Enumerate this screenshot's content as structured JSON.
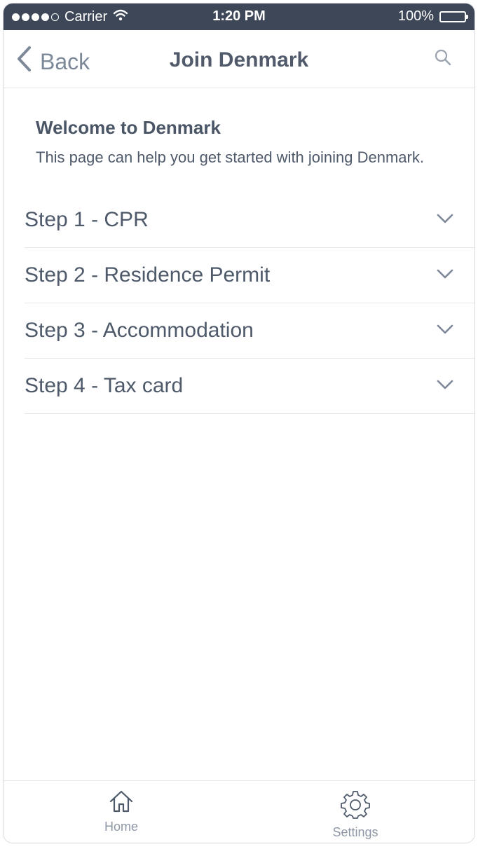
{
  "status_bar": {
    "carrier": "Carrier",
    "time": "1:20 PM",
    "battery": "100%",
    "signal_icon": "signal-dots-icon",
    "wifi_icon": "wifi-icon",
    "battery_icon": "battery-icon"
  },
  "nav": {
    "back_label": "Back",
    "title": "Join Denmark",
    "back_icon": "chevron-left-icon",
    "search_icon": "search-icon"
  },
  "welcome": {
    "title": "Welcome to Denmark",
    "text": "This page can help you get started with joining Denmark."
  },
  "steps": [
    {
      "label": "Step 1 - CPR"
    },
    {
      "label": "Step 2 - Residence Permit"
    },
    {
      "label": "Step 3 - Accommodation"
    },
    {
      "label": "Step 4 - Tax card"
    }
  ],
  "tabs": [
    {
      "label": "Home",
      "icon": "home-icon"
    },
    {
      "label": "Settings",
      "icon": "gear-icon"
    }
  ],
  "colors": {
    "status_bar_bg": "#3d4757",
    "text": "#4e596a",
    "muted": "#8e97a5"
  }
}
